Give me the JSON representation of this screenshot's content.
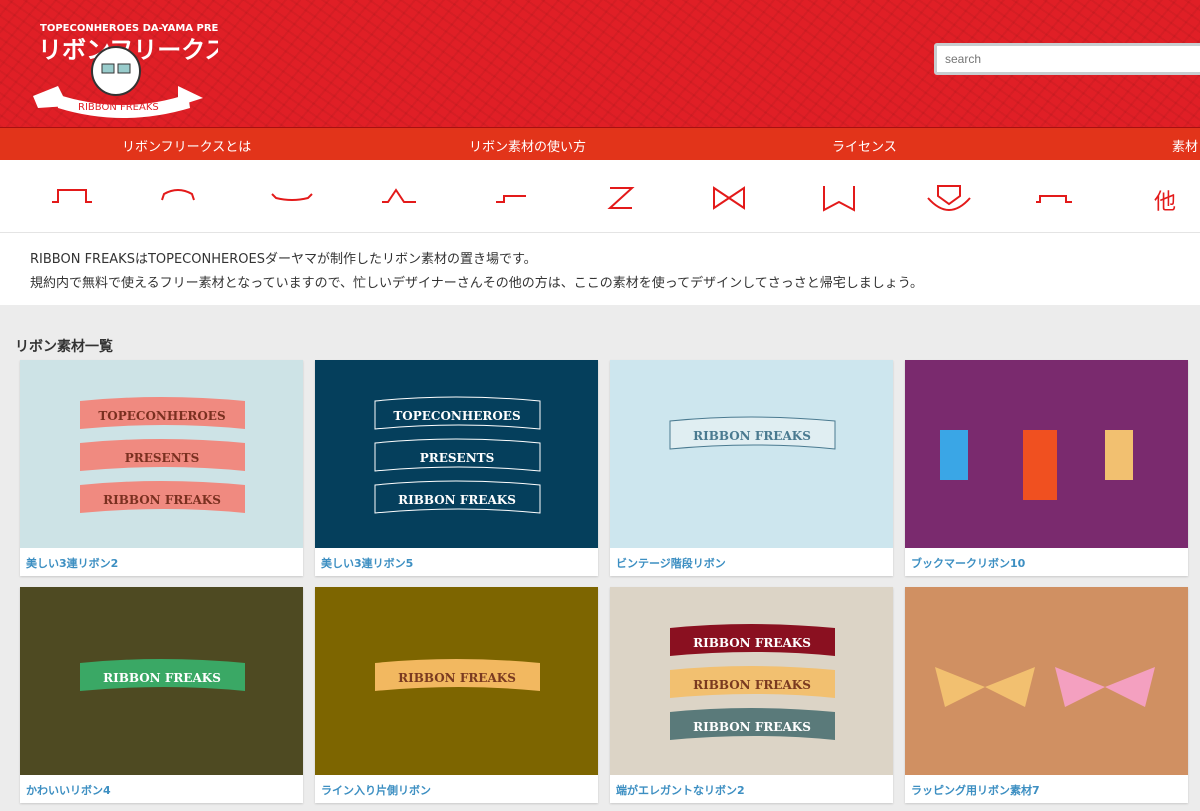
{
  "header": {
    "logo_top": "TOPECONHEROES DA-YAMA PRESENTS",
    "logo_jp": "リボンフリークス",
    "logo_ribbon": "RIBBON FREAKS",
    "search_placeholder": "search"
  },
  "nav": [
    "リボンフリークスとは",
    "リボン素材の使い方",
    "ライセンス",
    "素材リ"
  ],
  "categories": [
    "flat-ribbon-icon",
    "arch-ribbon-icon",
    "wave-ribbon-icon",
    "step-ribbon-icon",
    "corner-ribbon-icon",
    "z-ribbon-icon",
    "bow-ribbon-icon",
    "bookmark-ribbon-icon",
    "badge-ribbon-icon",
    "multi-ribbon-icon",
    "other"
  ],
  "other_label": "他",
  "intro": [
    "RIBBON FREAKSはTOPECONHEROESダーヤマが制作したリボン素材の置き場です。",
    "規約内で無料で使えるフリー素材となっていますので、忙しいデザイナーさんその他の方は、ここの素材を使ってデザインしてさっさと帰宅しましょう。"
  ],
  "list_title": "リボン素材一覧",
  "items": [
    {
      "title": "美しい3連リボン2",
      "bg": "#cde3e6",
      "lines": [
        "TOPECONHEROES",
        "PRESENTS",
        "RIBBON FREAKS"
      ]
    },
    {
      "title": "美しい3連リボン5",
      "bg": "#053f5c",
      "lines": [
        "TOPECONHEROES",
        "PRESENTS",
        "RIBBON FREAKS"
      ]
    },
    {
      "title": "ビンテージ階段リボン",
      "bg": "#cde6ee",
      "lines": [
        "RIBBON FREAKS"
      ]
    },
    {
      "title": "ブックマークリボン10",
      "bg": "#7a2a6e",
      "lines": []
    },
    {
      "title": "かわいいリボン4",
      "bg": "#4e4a22",
      "lines": [
        "RIBBON FREAKS"
      ]
    },
    {
      "title": "ライン入り片側リボン",
      "bg": "#7d6500",
      "lines": [
        "RIBBON FREAKS"
      ]
    },
    {
      "title": "端がエレガントなリボン2",
      "bg": "#dcd4c6",
      "lines": [
        "RIBBON FREAKS",
        "RIBBON FREAKS",
        "RIBBON FREAKS"
      ]
    },
    {
      "title": "ラッピング用リボン素材7",
      "bg": "#d09062",
      "lines": []
    }
  ]
}
